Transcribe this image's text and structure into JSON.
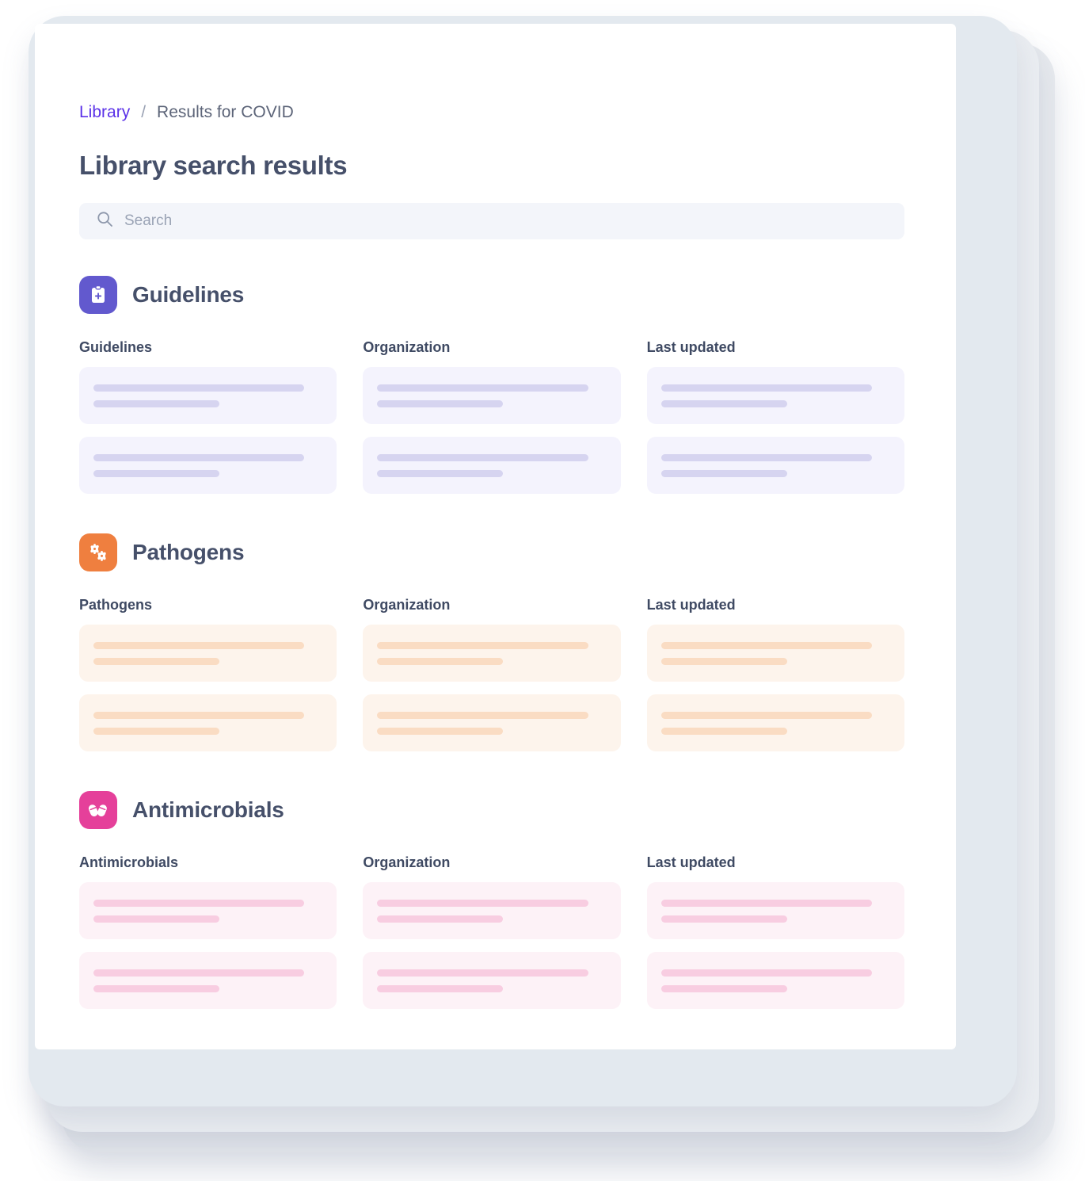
{
  "breadcrumb": {
    "link_label": "Library",
    "separator": "/",
    "current_label": "Results for COVID"
  },
  "page": {
    "title": "Library search results"
  },
  "search": {
    "placeholder": "Search",
    "value": "",
    "icon": "search-icon"
  },
  "colors": {
    "breadcrumb_link": "#5b32e8",
    "title": "#46506a",
    "guidelines_accent": "#6259ce",
    "pathogens_accent": "#ef7f3f",
    "antimicrobials_accent": "#e5409a",
    "frame": "#e3e9ef",
    "panel": "#ffffff",
    "search_bg": "#f3f5fa"
  },
  "sections": [
    {
      "id": "guidelines",
      "title": "Guidelines",
      "icon": "clipboard-plus-icon",
      "accent": "#6259ce",
      "card_bg": "#f4f3fd",
      "bar_color": "#d6d4f0",
      "columns": [
        {
          "header": "Guidelines",
          "rows": 2
        },
        {
          "header": "Organization",
          "rows": 2
        },
        {
          "header": "Last updated",
          "rows": 2
        }
      ]
    },
    {
      "id": "pathogens",
      "title": "Pathogens",
      "icon": "bacteria-icon",
      "accent": "#ef7f3f",
      "card_bg": "#fdf4ec",
      "bar_color": "#fadcc3",
      "columns": [
        {
          "header": "Pathogens",
          "rows": 2
        },
        {
          "header": "Organization",
          "rows": 2
        },
        {
          "header": "Last updated",
          "rows": 2
        }
      ]
    },
    {
      "id": "antimicrobials",
      "title": "Antimicrobials",
      "icon": "pills-icon",
      "accent": "#e5409a",
      "card_bg": "#fdf2f7",
      "bar_color": "#f8cde1",
      "columns": [
        {
          "header": "Antimicrobials",
          "rows": 2
        },
        {
          "header": "Organization",
          "rows": 2
        },
        {
          "header": "Last updated",
          "rows": 2
        }
      ]
    }
  ]
}
